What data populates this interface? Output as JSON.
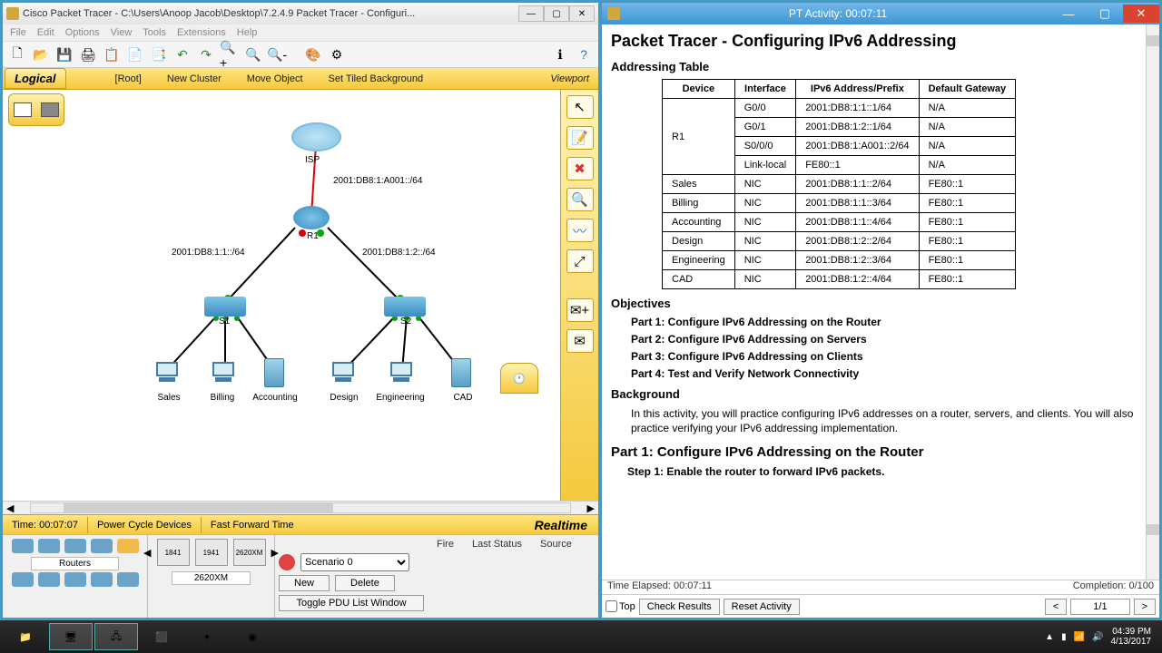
{
  "pt_window": {
    "title": "Cisco Packet Tracer - C:\\Users\\Anoop Jacob\\Desktop\\7.2.4.9 Packet Tracer - Configuri...",
    "menu": [
      "File",
      "Edit",
      "Options",
      "View",
      "Tools",
      "Extensions",
      "Help"
    ],
    "logical_bar": {
      "tab": "Logical",
      "root": "[Root]",
      "new_cluster": "New Cluster",
      "move_object": "Move Object",
      "set_bg": "Set Tiled Background",
      "viewport": "Viewport"
    },
    "subnets": {
      "isp": "2001:DB8:1:A001::/64",
      "left": "2001:DB8:1:1::/64",
      "right": "2001:DB8:1:2::/64"
    },
    "labels": {
      "isp": "ISP",
      "r1": "R1",
      "s1": "S1",
      "s2": "S2",
      "sales": "Sales",
      "billing": "Billing",
      "accounting": "Accounting",
      "design": "Design",
      "engineering": "Engineering",
      "cad": "CAD"
    },
    "timebar": {
      "time": "Time: 00:07:07",
      "pcd": "Power Cycle Devices",
      "fft": "Fast Forward Time",
      "realtime": "Realtime"
    },
    "devpanel": {
      "category": "Routers",
      "models": [
        "1841",
        "1941",
        "2620XM"
      ],
      "selected_model": "2620XM"
    },
    "sim": {
      "scenario": "Scenario 0",
      "new": "New",
      "delete": "Delete",
      "toggle": "Toggle PDU List Window",
      "cols": [
        "Fire",
        "Last Status",
        "Source"
      ]
    }
  },
  "activity": {
    "title": "PT Activity: 00:07:11",
    "h1": "Packet Tracer - Configuring IPv6 Addressing",
    "addr_heading": "Addressing Table",
    "table": {
      "headers": [
        "Device",
        "Interface",
        "IPv6 Address/Prefix",
        "Default Gateway"
      ],
      "rows": [
        [
          "R1",
          "G0/0",
          "2001:DB8:1:1::1/64",
          "N/A"
        ],
        [
          "",
          "G0/1",
          "2001:DB8:1:2::1/64",
          "N/A"
        ],
        [
          "",
          "S0/0/0",
          "2001:DB8:1:A001::2/64",
          "N/A"
        ],
        [
          "",
          "Link-local",
          "FE80::1",
          "N/A"
        ],
        [
          "Sales",
          "NIC",
          "2001:DB8:1:1::2/64",
          "FE80::1"
        ],
        [
          "Billing",
          "NIC",
          "2001:DB8:1:1::3/64",
          "FE80::1"
        ],
        [
          "Accounting",
          "NIC",
          "2001:DB8:1:1::4/64",
          "FE80::1"
        ],
        [
          "Design",
          "NIC",
          "2001:DB8:1:2::2/64",
          "FE80::1"
        ],
        [
          "Engineering",
          "NIC",
          "2001:DB8:1:2::3/64",
          "FE80::1"
        ],
        [
          "CAD",
          "NIC",
          "2001:DB8:1:2::4/64",
          "FE80::1"
        ]
      ]
    },
    "objectives_h": "Objectives",
    "objectives": [
      "Part 1: Configure IPv6 Addressing on the Router",
      "Part 2: Configure IPv6 Addressing on Servers",
      "Part 3: Configure IPv6 Addressing on Clients",
      "Part 4: Test and Verify Network Connectivity"
    ],
    "background_h": "Background",
    "background": "In this activity, you will practice configuring IPv6 addresses on a router, servers, and clients. You will also practice verifying your IPv6 addressing implementation.",
    "part1_h": "Part 1:  Configure IPv6 Addressing on the Router",
    "step1": "Step 1:   Enable the router to forward IPv6 packets.",
    "status": {
      "elapsed": "Time Elapsed: 00:07:11",
      "completion": "Completion: 0/100"
    },
    "btns": {
      "top": "Top",
      "check": "Check Results",
      "reset": "Reset Activity",
      "prev": "<",
      "page": "1/1",
      "next": ">"
    }
  },
  "taskbar": {
    "time": "04:39 PM",
    "date": "4/13/2017"
  }
}
